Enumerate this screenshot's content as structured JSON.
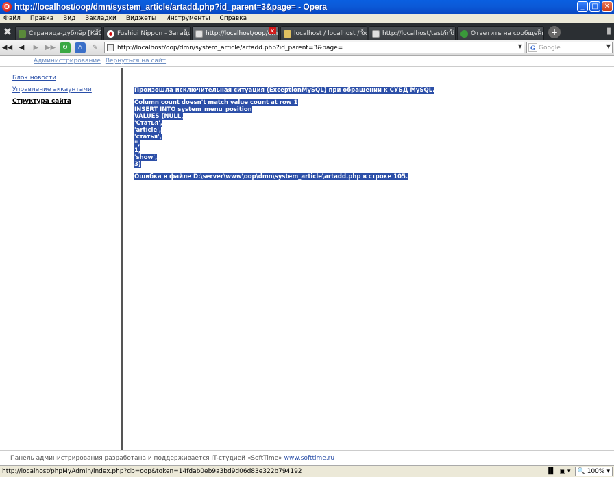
{
  "window": {
    "title": "http://localhost/oop/dmn/system_article/artadd.php?id_parent=3&page= - Opera",
    "icon": "opera-icon"
  },
  "menu": [
    "Файл",
    "Правка",
    "Вид",
    "Закладки",
    "Виджеты",
    "Инструменты",
    "Справка"
  ],
  "tabs": [
    {
      "label": "Страница-дублёр [Каб...",
      "color": "#5a8a3a"
    },
    {
      "label": "Fushigi Nippon - Загадо...",
      "color": "#d01010"
    },
    {
      "label": "http://localhost/oop/dm...",
      "color": "#e0e0e0",
      "active": true
    },
    {
      "label": "localhost / localhost / oo...",
      "color": "#e0c060"
    },
    {
      "label": "http://localhost/test/ind...",
      "color": "#e0e0e0"
    },
    {
      "label": "Ответить на сообщение",
      "color": "#3a9a3a"
    }
  ],
  "address": {
    "url": "http://localhost/oop/dmn/system_article/artadd.php?id_parent=3&page=",
    "search_placeholder": "Google"
  },
  "topnav": {
    "admin": "Администрирование",
    "back": "Вернуться на сайт"
  },
  "sidebar": {
    "items": [
      {
        "label": "Блок новости"
      },
      {
        "label": "Управление аккаунтами"
      },
      {
        "label": "Структура сайта"
      }
    ]
  },
  "error": {
    "heading": "Произошла исключительная ситуация (ExceptionMySQL) при обращении к СУБД MySQL.",
    "lines": [
      "Column count doesn't match value count at row 1",
      "INSERT INTO system_menu_position",
      "VALUES (NULL,",
      "'Статья',",
      "'article',",
      "'статья',",
      "'',",
      "1,",
      "'show',",
      "3)"
    ],
    "file_line": "Ошибка в файле D:\\server\\www\\oop\\dmn\\system_article\\artadd.php в строке 105."
  },
  "footer": {
    "text": "Панель администрирования разработана и поддерживается IT-студией «SoftTime»",
    "link": "www.softtime.ru"
  },
  "status": {
    "url": "http://localhost/phpMyAdmin/index.php?db=oop&token=14fdab0eb9a3bd9d06d83e322b794192",
    "zoom": "100%"
  }
}
